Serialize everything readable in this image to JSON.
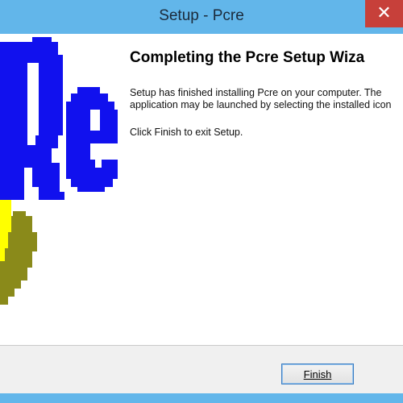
{
  "window": {
    "title": "Setup - Pcre",
    "close_symbol": "✕"
  },
  "banner": {
    "logo_text": "Re",
    "logo_text_color": "#1111ee",
    "moon_colors": [
      "#ffff00",
      "#8a8a1a"
    ]
  },
  "page": {
    "heading": "Completing the Pcre Setup Wiza",
    "body_lines": [
      "Setup has finished installing Pcre on your computer. The",
      "application may be launched by selecting the installed icon"
    ],
    "instruction": "Click Finish to exit Setup."
  },
  "footer": {
    "finish_label": "Finish"
  },
  "colors": {
    "titlebar": "#62b6ea",
    "close_button": "#c7403a",
    "button_border": "#3a7cc2"
  }
}
